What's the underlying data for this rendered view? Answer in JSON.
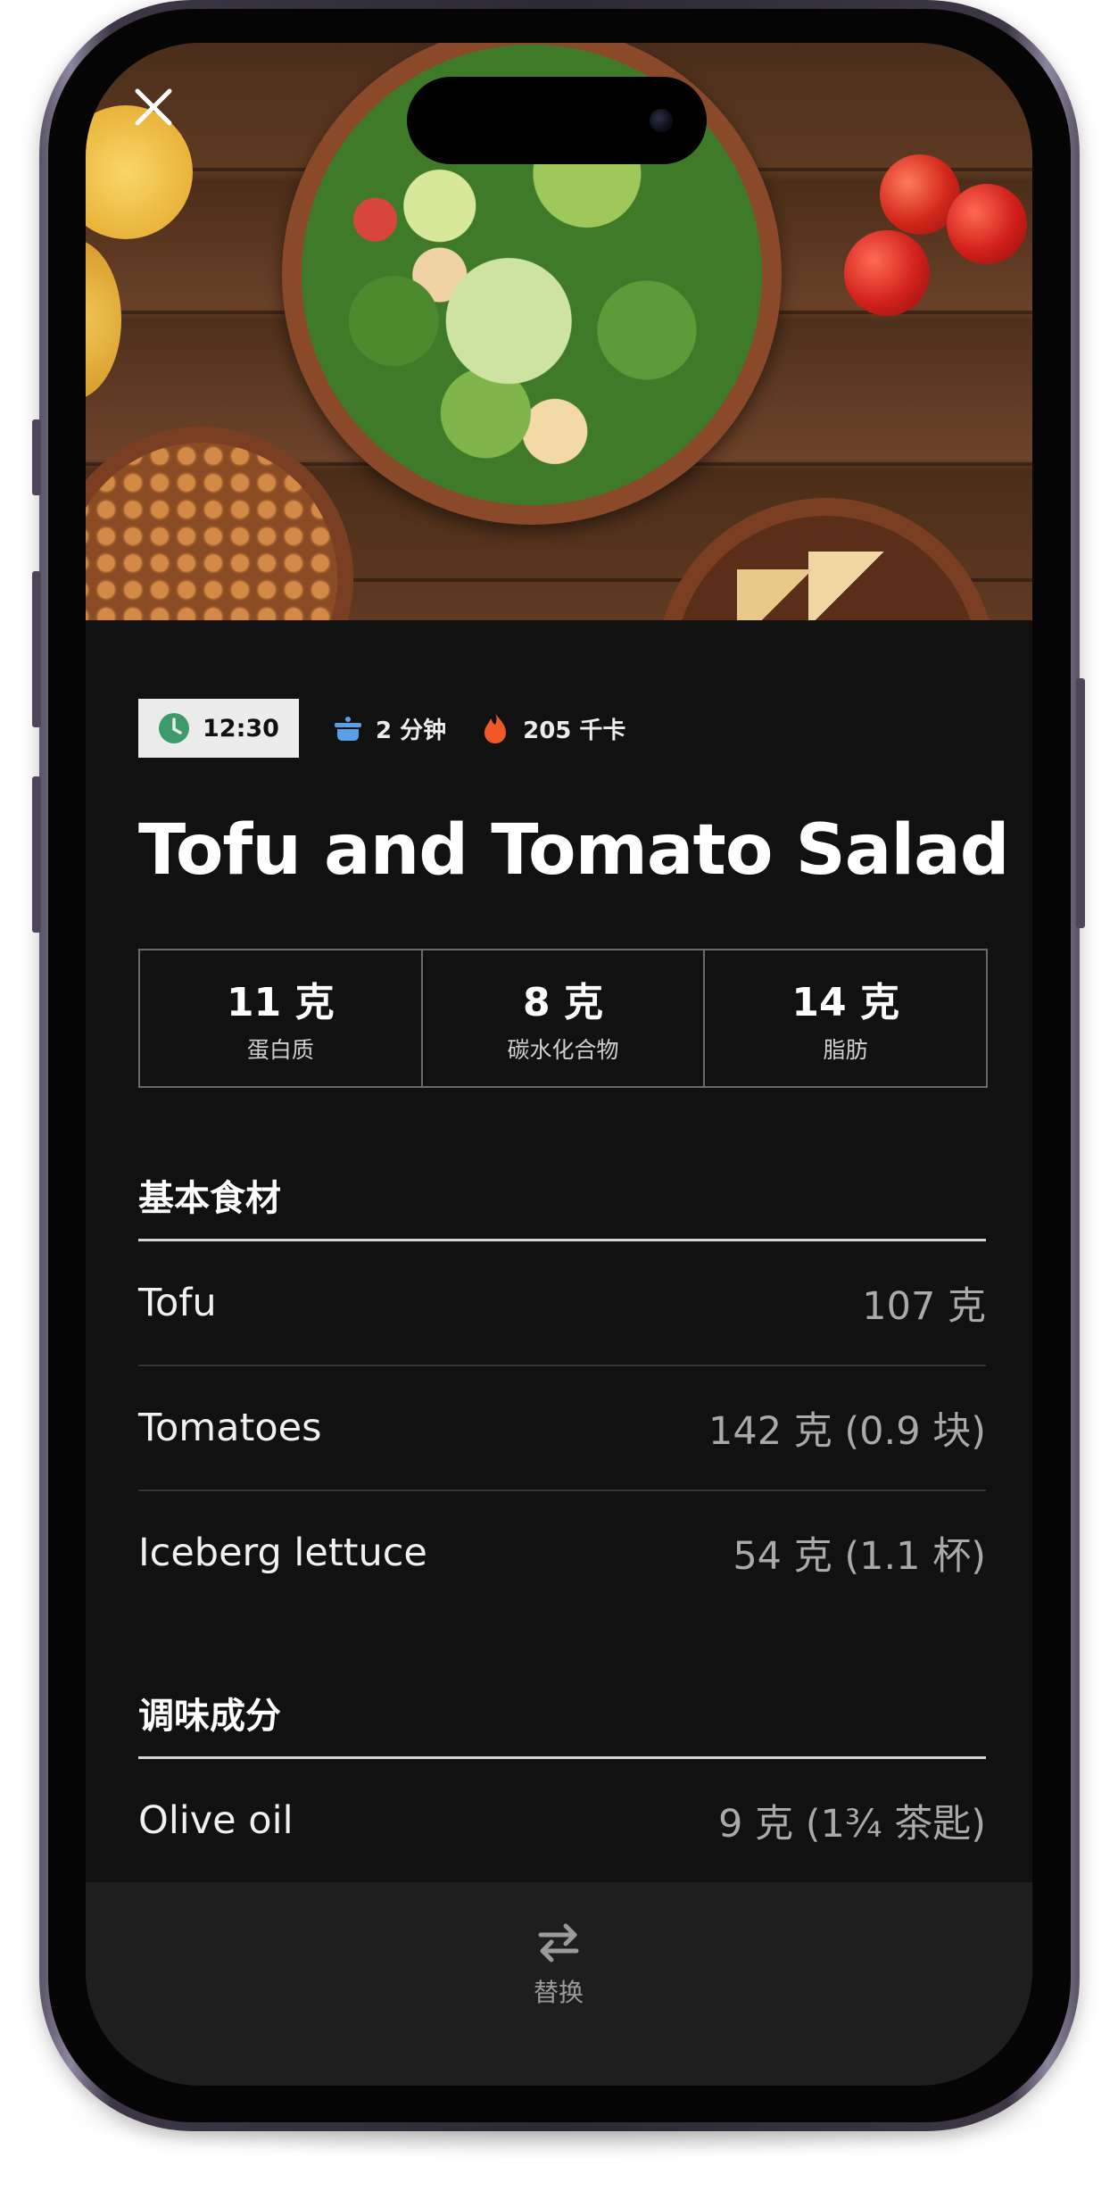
{
  "recipe": {
    "time": "12:30",
    "prep_time": "2 分钟",
    "calories": "205 千卡",
    "title": "Tofu and Tomato Salad"
  },
  "macros": [
    {
      "value": "11 克",
      "label": "蛋白质"
    },
    {
      "value": "8 克",
      "label": "碳水化合物"
    },
    {
      "value": "14 克",
      "label": "脂肪"
    }
  ],
  "sections": {
    "main": {
      "title": "基本食材",
      "items": [
        {
          "name": "Tofu",
          "qty": "107 克"
        },
        {
          "name": "Tomatoes",
          "qty": "142 克 (0.9 块)"
        },
        {
          "name": "Iceberg lettuce",
          "qty": "54 克 (1.1 杯)"
        }
      ]
    },
    "seasoning": {
      "title": "调味成分",
      "items": [
        {
          "name": "Olive oil",
          "qty": "9 克 (1¾ 茶匙)"
        }
      ]
    }
  },
  "bottom_bar": {
    "swap_label": "替换"
  },
  "icons": {
    "close": "close-icon",
    "clock": "clock-icon",
    "pot": "pot-icon",
    "flame": "flame-icon",
    "swap": "swap-arrows-icon"
  },
  "colors": {
    "clock_green": "#3c9a6b",
    "pot_blue": "#5aa0e6",
    "flame_orange": "#f0582a",
    "background": "#111111"
  }
}
